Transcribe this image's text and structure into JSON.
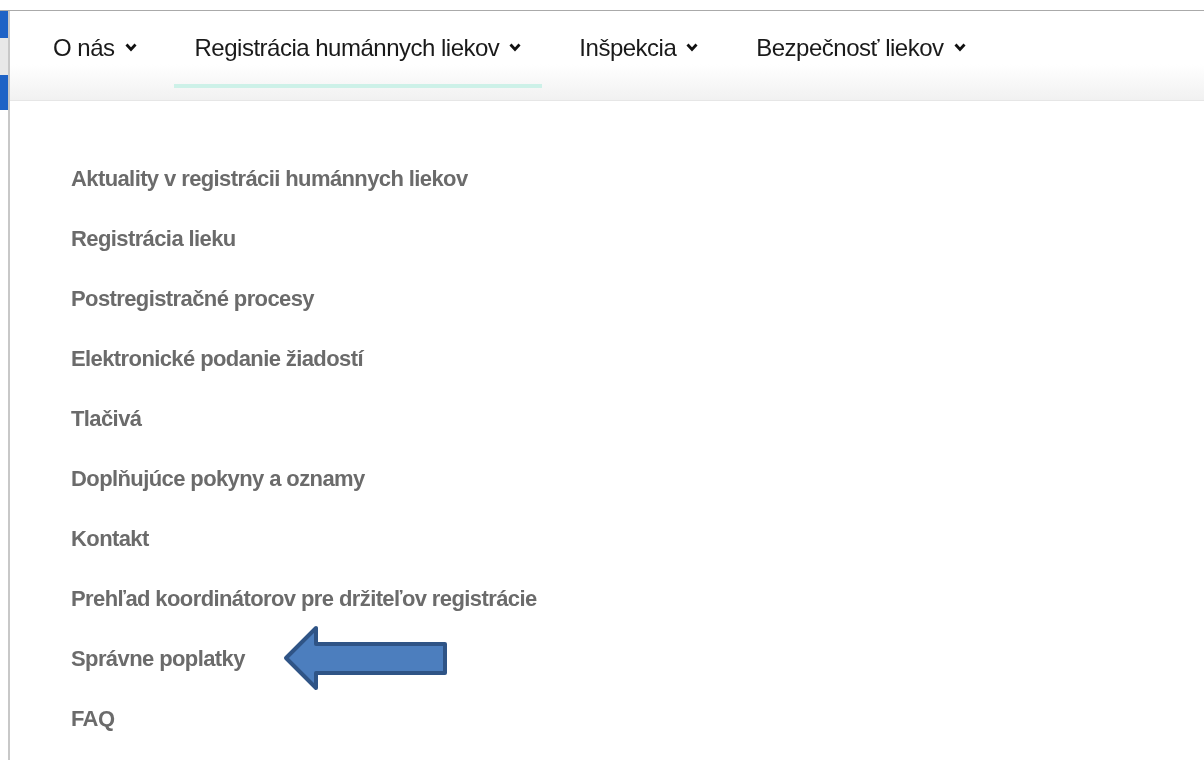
{
  "nav": [
    {
      "label": "O nás",
      "selected": false
    },
    {
      "label": "Registrácia humánnych liekov",
      "selected": true
    },
    {
      "label": "Inšpekcia",
      "selected": false
    },
    {
      "label": "Bezpečnosť liekov",
      "selected": false
    }
  ],
  "menu": [
    {
      "label": "Aktuality v registrácii humánnych liekov",
      "pointed": false
    },
    {
      "label": "Registrácia lieku",
      "pointed": false
    },
    {
      "label": "Postregistračné procesy",
      "pointed": false
    },
    {
      "label": "Elektronické podanie žiadostí",
      "pointed": false
    },
    {
      "label": "Tlačivá",
      "pointed": false
    },
    {
      "label": "Doplňujúce pokyny a oznamy",
      "pointed": false
    },
    {
      "label": "Kontakt",
      "pointed": false
    },
    {
      "label": "Prehľad koordinátorov pre držiteľov registrácie",
      "pointed": false
    },
    {
      "label": "Správne poplatky",
      "pointed": true
    },
    {
      "label": "FAQ",
      "pointed": false
    }
  ]
}
